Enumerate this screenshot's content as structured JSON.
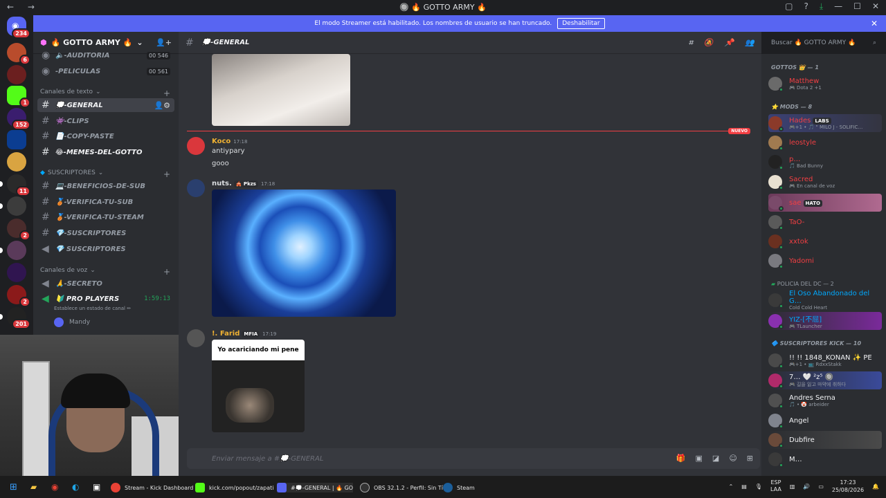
{
  "window": {
    "title": "🔘 🔥 GOTTO ARMY 🔥",
    "nav": "← →"
  },
  "banner": {
    "text": "El modo Streamer está habilitado. Los nombres de usuario se han truncado.",
    "button": "Deshabilitar"
  },
  "servers": {
    "home_badge": "234",
    "badges": [
      "6",
      "1",
      "152",
      "11",
      "2",
      "2",
      "201"
    ]
  },
  "guild": {
    "name": "🔥 GOTTO ARMY 🔥"
  },
  "channels": {
    "voice_top": [
      {
        "name": "🔈-AUDITORIA",
        "count": "00 546"
      },
      {
        "name": "-PELICULAS",
        "count": "00 561"
      }
    ],
    "text_category": "Canales de texto",
    "text": [
      {
        "name": "💭-GENERAL"
      },
      {
        "name": "👾-CLIPS"
      },
      {
        "name": "📄-COPY-PASTE"
      },
      {
        "name": "😂-MEMES-DEL-GOTTO"
      }
    ],
    "subs_category": "SUSCRIPTORES",
    "subs": [
      {
        "name": "💻-BENEFICIOS-DE-SUB"
      },
      {
        "name": "🥉-VERIFICA-TU-SUB"
      },
      {
        "name": "🥉-VERIFICA-TU-STEAM"
      },
      {
        "name": "💎-SUSCRIPTORES"
      },
      {
        "name": "💎 SUSCRIPTORES"
      }
    ],
    "voice_category": "Canales de voz",
    "voice": [
      {
        "name": "🙏-SECRETO"
      },
      {
        "name": "🔰 PRO PLAYERS",
        "timer": "1:59:13",
        "status": "Establece un estado de canal ✏"
      }
    ],
    "voice_users": [
      "Mandy"
    ]
  },
  "chat": {
    "channel": "💭-GENERAL",
    "new_label": "NUEVO",
    "messages": [
      {
        "author": "Koco",
        "time": "17:18",
        "lines": [
          "antiypary",
          "gooo"
        ]
      },
      {
        "author": "nuts.",
        "tag": "🎪 Pkzs",
        "time": "17:18"
      },
      {
        "author": "!. Farid",
        "tag": "MFIA",
        "time": "17:19",
        "caption": "Yo acariciando mi pene"
      }
    ],
    "composer_placeholder": "Enviar mensaje a #💭-GENERAL"
  },
  "search": {
    "placeholder": "Buscar 🔥 GOTTO ARMY 🔥"
  },
  "members": {
    "categories": [
      {
        "name": "GOTTOS 👑 — 1"
      },
      {
        "name": "⭐ MODS — 8"
      },
      {
        "name": "POLICIA DEL DC — 2"
      },
      {
        "name": "🔷 SUSCRIPTORES KICK — 10"
      }
    ],
    "list": [
      {
        "name": "Matthew",
        "activity": "🎮 Dota 2 +1",
        "color": "#f23f43"
      },
      {
        "name": "Hades",
        "tag": "LABS",
        "activity": "🎮+1 • 🎵 \" MILO J - SOLIFIC…",
        "color": "#f23f43"
      },
      {
        "name": "leostyle",
        "activity": "",
        "color": "#f23f43"
      },
      {
        "name": "p…",
        "activity": "🎵 Bad Bunny",
        "color": "#f23f43"
      },
      {
        "name": "Sacred",
        "activity": "🎮 En canal de voz",
        "color": "#f23f43"
      },
      {
        "name": "sae",
        "tag": "HATO",
        "activity": "",
        "color": "#f23f43"
      },
      {
        "name": "TaO-",
        "activity": "",
        "color": "#f23f43"
      },
      {
        "name": "xxtok",
        "activity": "",
        "color": "#f23f43"
      },
      {
        "name": "Yadomi",
        "activity": "",
        "color": "#f23f43"
      },
      {
        "name": "El Oso Abandonado del G…",
        "activity": "Cold Cold Heart",
        "color": "#00a8fc"
      },
      {
        "name": "YIZ-[不屈]",
        "activity": "🎮 TLauncher",
        "color": "#00a8fc"
      },
      {
        "name": "!! !! 1848_KONAN ✨ PE",
        "activity": "🎮+1 • 📺 RdxxStakk",
        "color": "#f2f3f5"
      },
      {
        "name": "7… 🤍 ²z⁵ 🔘",
        "activity": "🎮 길을 잃고 마약에 취하다",
        "color": "#f2f3f5"
      },
      {
        "name": "Andres Serna",
        "activity": "🎵 • 🤡 arbeider",
        "color": "#f2f3f5"
      },
      {
        "name": "Angel",
        "activity": "",
        "color": "#f2f3f5"
      },
      {
        "name": "Dubfire",
        "activity": "",
        "color": "#f2f3f5"
      },
      {
        "name": "M…",
        "activity": "",
        "color": "#f2f3f5"
      }
    ]
  },
  "taskbar": {
    "items": [
      "Stream - Kick Dashboard",
      "kick.com/popout/zapati",
      "#💭-GENERAL | 🔥 GO",
      "OBS 32.1.2 - Perfil: Sin Tí",
      "Steam"
    ],
    "lang": "ESP",
    "lang2": "LAA",
    "time": "17:23",
    "date": "25/08/2026"
  }
}
